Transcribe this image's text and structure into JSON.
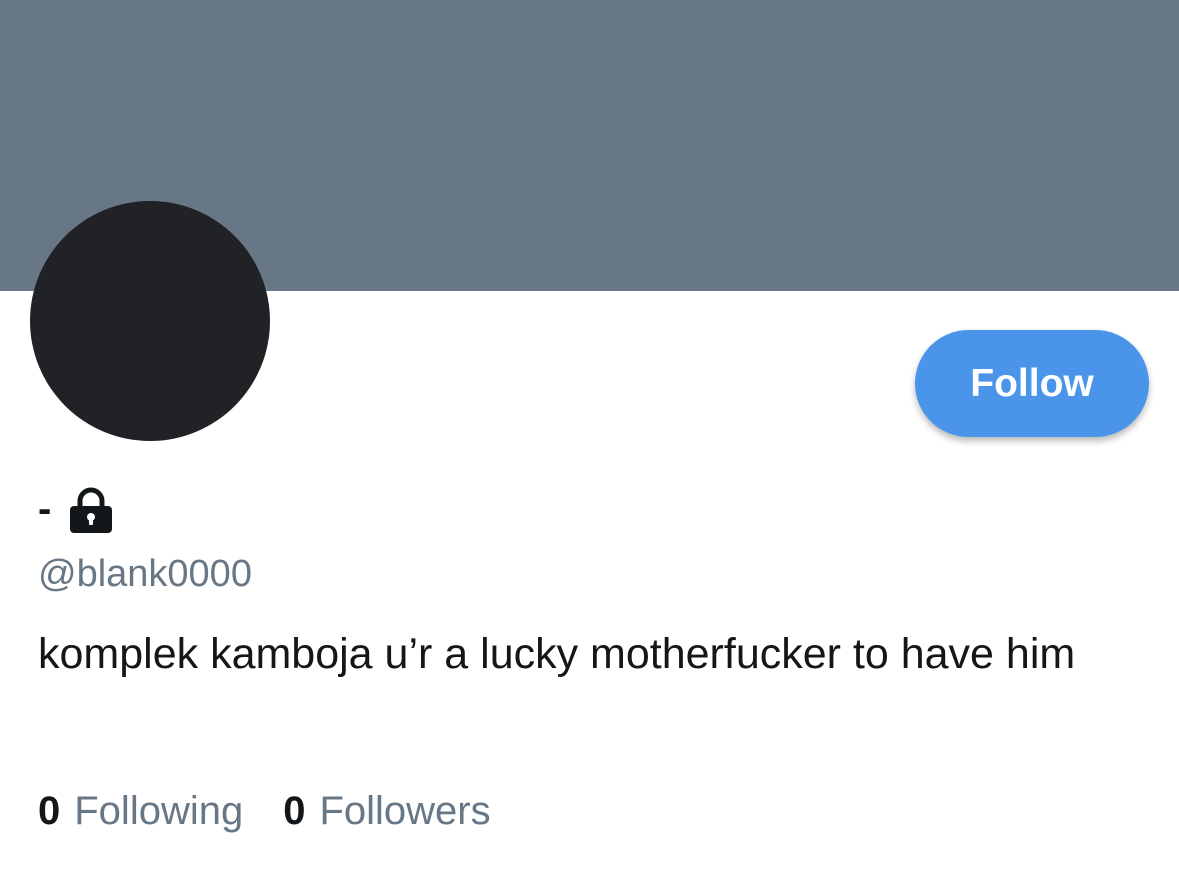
{
  "profile": {
    "display_name": "-",
    "handle": "@blank0000",
    "bio": "komplek kamboja u’r a lucky motherfucker to have him",
    "protected_icon": "lock-icon"
  },
  "actions": {
    "follow_label": "Follow"
  },
  "stats": {
    "following_count": "0",
    "following_label": "Following",
    "followers_count": "0",
    "followers_label": "Followers"
  },
  "colors": {
    "banner": "#687785",
    "avatar": "#212226",
    "follow_button": "#4a94ea",
    "secondary_text": "#687785",
    "primary_text": "#14171a"
  }
}
